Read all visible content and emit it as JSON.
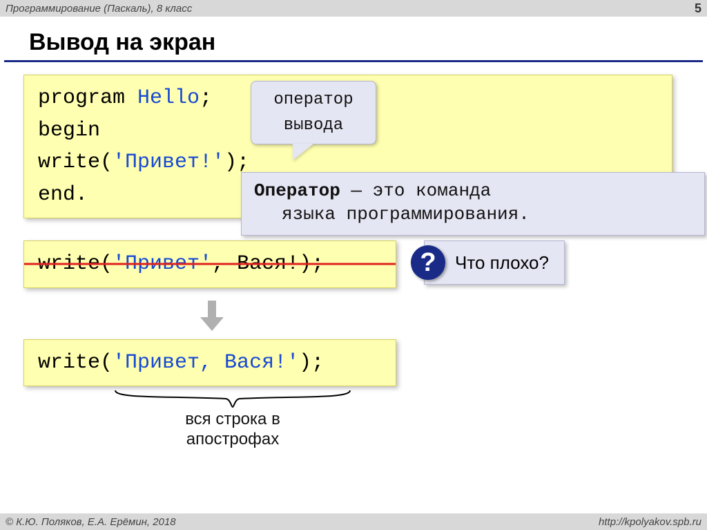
{
  "header": {
    "course": "Программирование (Паскаль), 8 класс",
    "page_number": "5"
  },
  "title": "Вывод на экран",
  "code_main": {
    "line1_kw": "program",
    "line1_ident": "Hello",
    "line1_semi": ";",
    "line2": "begin",
    "line3_indent": " ",
    "line3_write": "write(",
    "line3_str": "'Привет!'",
    "line3_close": ");",
    "line4": "end."
  },
  "callout": {
    "line1": "оператор",
    "line2": "вывода"
  },
  "definition": {
    "term": "Оператор",
    "rest1": " — это команда",
    "rest2": "языка программирования."
  },
  "wrong_code": {
    "write": "write(",
    "str": "'Привет'",
    "rest": ", Вася!);"
  },
  "question": {
    "mark": "?",
    "text": "Что плохо?"
  },
  "correct_code": {
    "write": "write(",
    "str": "'Привет, Вася!'",
    "close": ");"
  },
  "brace_caption": {
    "line1": "вся строка в",
    "line2": "апострофах"
  },
  "footer": {
    "copyright": "© К.Ю. Поляков, Е.А. Ерёмин, 2018",
    "url": "http://kpolyakov.spb.ru"
  }
}
